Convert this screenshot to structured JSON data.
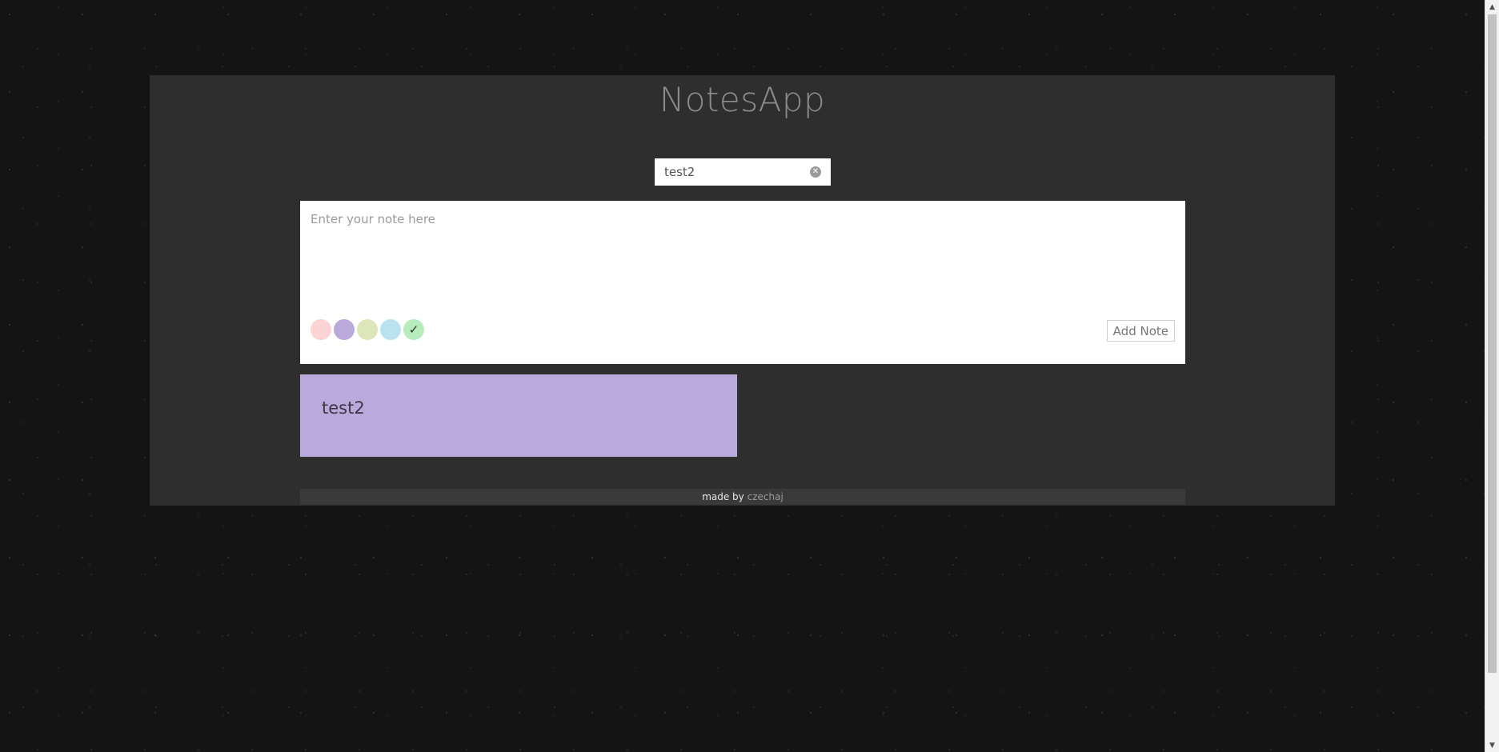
{
  "app": {
    "title": "NotesApp"
  },
  "search": {
    "value": "test2",
    "clear_icon": "clear-circle-icon"
  },
  "composer": {
    "placeholder": "Enter your note here",
    "value": "",
    "add_button_label": "Add Note",
    "colors": [
      {
        "name": "pink",
        "hex": "#fbd3d3",
        "selected": false
      },
      {
        "name": "purple",
        "hex": "#baa9db",
        "selected": false
      },
      {
        "name": "olive",
        "hex": "#dde6b8",
        "selected": false
      },
      {
        "name": "blue",
        "hex": "#b9e2ee",
        "selected": false
      },
      {
        "name": "green",
        "hex": "#b6ecbc",
        "selected": true
      }
    ],
    "selected_mark": "✓"
  },
  "notes": [
    {
      "text": "test2",
      "color": "#baa9db"
    }
  ],
  "footer": {
    "prefix": "made by",
    "author": "czechaj"
  },
  "colors": {
    "background": "#141414",
    "panel": "#343434",
    "title": "#8c8c8c",
    "footer_bar": "#3a3a3a"
  }
}
